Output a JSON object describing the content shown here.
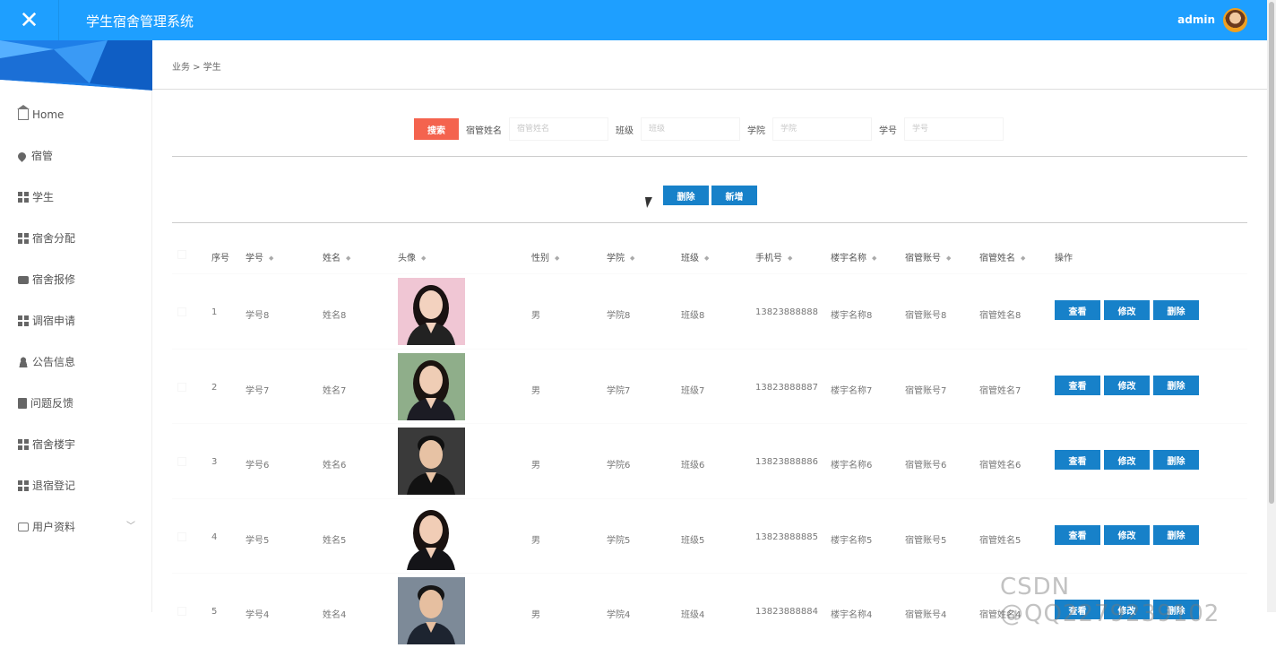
{
  "app": {
    "title": "学生宿舍管理系统",
    "close_glyph": "✕",
    "user": "admin"
  },
  "sidebar": {
    "items": [
      {
        "label": "Home",
        "icon": "home-icon"
      },
      {
        "label": "宿管",
        "icon": "pin-icon"
      },
      {
        "label": "学生",
        "icon": "grid-icon"
      },
      {
        "label": "宿舍分配",
        "icon": "grid-icon"
      },
      {
        "label": "宿舍报修",
        "icon": "briefcase-icon"
      },
      {
        "label": "调宿申请",
        "icon": "grid-icon"
      },
      {
        "label": "公告信息",
        "icon": "user-icon"
      },
      {
        "label": "问题反馈",
        "icon": "clipboard-icon"
      },
      {
        "label": "宿舍楼宇",
        "icon": "grid-icon"
      },
      {
        "label": "退宿登记",
        "icon": "grid-icon"
      },
      {
        "label": "用户资料",
        "icon": "card-icon",
        "chevron": "﹀"
      }
    ]
  },
  "breadcrumb": "业务 > 学生",
  "search": {
    "button": "搜索",
    "fields": [
      {
        "label": "宿管姓名",
        "placeholder": "宿管姓名"
      },
      {
        "label": "班级",
        "placeholder": "班级"
      },
      {
        "label": "学院",
        "placeholder": "学院"
      },
      {
        "label": "学号",
        "placeholder": "学号"
      }
    ]
  },
  "toolbar": {
    "delete": "删除",
    "add": "新增"
  },
  "table": {
    "columns": [
      "序号",
      "学号",
      "姓名",
      "头像",
      "性别",
      "学院",
      "班级",
      "手机号",
      "楼宇名称",
      "宿管账号",
      "宿管姓名",
      "操作"
    ],
    "sort_glyph": "◆",
    "row_buttons": {
      "view": "查看",
      "edit": "修改",
      "delete": "删除"
    },
    "rows": [
      {
        "idx": "1",
        "sno": "学号8",
        "name": "姓名8",
        "gender": "男",
        "college": "学院8",
        "class": "班级8",
        "phone": "13823888888",
        "building": "楼宇名称8",
        "account": "宿管账号8",
        "manager": "宿管姓名8",
        "photo": "woman-portrait-pink"
      },
      {
        "idx": "2",
        "sno": "学号7",
        "name": "姓名7",
        "gender": "男",
        "college": "学院7",
        "class": "班级7",
        "phone": "13823888887",
        "building": "楼宇名称7",
        "account": "宿管账号7",
        "manager": "宿管姓名7",
        "photo": "woman-portrait-outdoor"
      },
      {
        "idx": "3",
        "sno": "学号6",
        "name": "姓名6",
        "gender": "男",
        "college": "学院6",
        "class": "班级6",
        "phone": "13823888886",
        "building": "楼宇名称6",
        "account": "宿管账号6",
        "manager": "宿管姓名6",
        "photo": "man-portrait-dark"
      },
      {
        "idx": "4",
        "sno": "学号5",
        "name": "姓名5",
        "gender": "男",
        "college": "学院5",
        "class": "班级5",
        "phone": "13823888885",
        "building": "楼宇名称5",
        "account": "宿管账号5",
        "manager": "宿管姓名5",
        "photo": "woman-portrait-white"
      },
      {
        "idx": "5",
        "sno": "学号4",
        "name": "姓名4",
        "gender": "男",
        "college": "学院4",
        "class": "班级4",
        "phone": "13823888884",
        "building": "楼宇名称4",
        "account": "宿管账号4",
        "manager": "宿管姓名4",
        "photo": "man-portrait-grey"
      }
    ]
  },
  "watermark": "CSDN @QQ2279239102",
  "colors": {
    "topbar": "#1e9fff",
    "search_button": "#f4634e",
    "action_button": "#1781c9"
  }
}
